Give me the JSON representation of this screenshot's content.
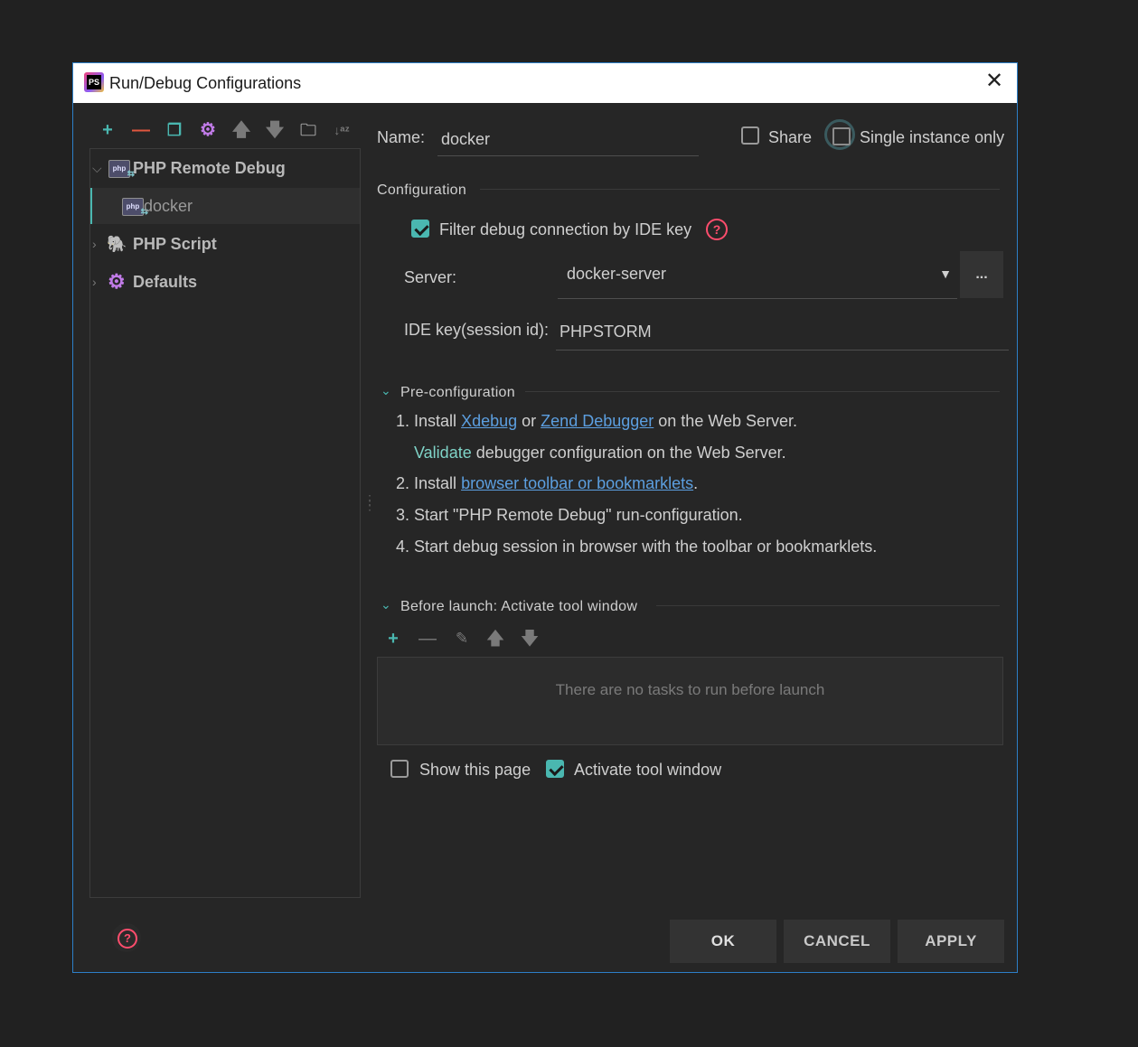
{
  "window": {
    "title": "Run/Debug Configurations"
  },
  "toolbar": {
    "icons": [
      "add-icon",
      "remove-icon",
      "copy-icon",
      "gear-icon",
      "move-up-icon",
      "move-down-icon",
      "folder-icon",
      "sort-az-icon"
    ]
  },
  "tree": {
    "items": [
      {
        "label": "PHP Remote Debug",
        "expanded": true
      },
      {
        "label": "docker",
        "selected": true
      },
      {
        "label": "PHP Script",
        "expanded": false
      },
      {
        "label": "Defaults",
        "expanded": false
      }
    ]
  },
  "form": {
    "name_label": "Name:",
    "name_value": "docker",
    "share_label": "Share",
    "share_checked": false,
    "single_instance_label": "Single instance only",
    "single_instance_checked": false
  },
  "configuration": {
    "title": "Configuration",
    "filter_label": "Filter debug connection by IDE key",
    "filter_checked": true,
    "server_label": "Server:",
    "server_value": "docker-server",
    "browse_label": "...",
    "ide_key_label": "IDE key(session id):",
    "ide_key_value": "PHPSTORM"
  },
  "preconfig": {
    "title": "Pre-configuration",
    "step1_prefix": "1. Install",
    "step1_link1": "Xdebug",
    "step1_or": "or",
    "step1_link2": "Zend Debugger",
    "step1_suffix": "on the Web Server.",
    "validate_word": "Validate",
    "validate_rest": "debugger configuration on the Web Server.",
    "step2_prefix": "2. Install",
    "step2_link": "browser toolbar or bookmarklets",
    "step2_suffix": ".",
    "step3": "3. Start \"PHP Remote Debug\" run-configuration.",
    "step4": "4. Start debug session in browser with the toolbar or bookmarklets."
  },
  "before_launch": {
    "title": "Before launch: Activate tool window",
    "empty_text": "There are no tasks to run before launch",
    "show_page_label": "Show this page",
    "show_page_checked": false,
    "activate_label": "Activate tool window",
    "activate_checked": true
  },
  "buttons": {
    "ok": "OK",
    "cancel": "CANCEL",
    "apply": "APPLY"
  },
  "colors": {
    "accent": "#4ab7b0",
    "link": "#5c9fe0",
    "help": "#ff4d6d",
    "border": "#2d7fc7"
  }
}
